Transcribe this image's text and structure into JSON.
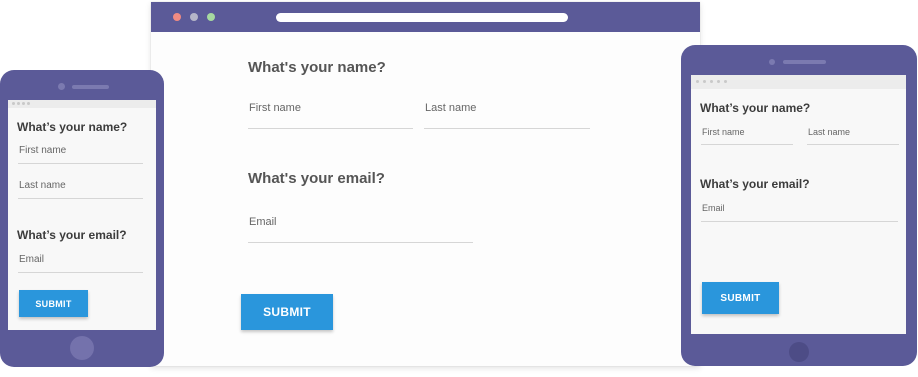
{
  "colors": {
    "frame": "#5b5a98",
    "submit": "#2a96dc",
    "heading": "#555555",
    "traffic_red": "#f28b82",
    "traffic_gray": "#b5b5c8",
    "traffic_green": "#a6d9a0"
  },
  "desktop": {
    "name_heading": "What's your name?",
    "first_name_placeholder": "First name",
    "last_name_placeholder": "Last name",
    "email_heading": "What's your email?",
    "email_placeholder": "Email",
    "submit_label": "SUBMIT"
  },
  "phone": {
    "name_heading": "What’s your name?",
    "first_name_placeholder": "First name",
    "last_name_placeholder": "Last name",
    "email_heading": "What’s your email?",
    "email_placeholder": "Email",
    "submit_label": "SUBMIT"
  },
  "tablet": {
    "name_heading": "What’s your name?",
    "first_name_placeholder": "First name",
    "last_name_placeholder": "Last name",
    "email_heading": "What’s your email?",
    "email_placeholder": "Email",
    "submit_label": "SUBMIT"
  }
}
